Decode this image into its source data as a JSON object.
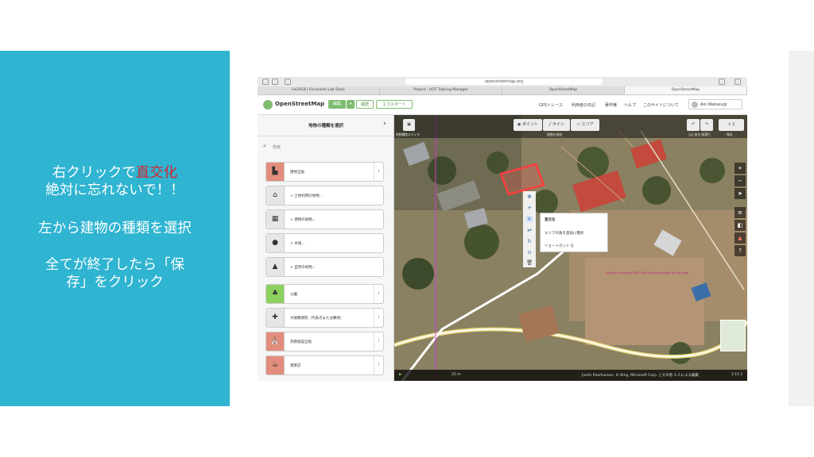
{
  "slide": {
    "line1_prefix": "右クリックで",
    "line1_highlight": "直交化",
    "line2": "絶対に忘れないで！！",
    "line3": "左から建物の種類を選択",
    "line4": "全てが終了したら「保",
    "line5": "存」をクリック",
    "highlight_color": "#d8232a",
    "panel_color": "#2fb4d1"
  },
  "browser": {
    "url": "openstreetmap.org",
    "tabs": [
      {
        "label": "sis2018 | Furuhashi Lab Slack"
      },
      {
        "label": "Project - HOT Tasking Manager"
      },
      {
        "label": "OpenStreetMap"
      },
      {
        "label": "OpenStreetMap"
      }
    ]
  },
  "osm_header": {
    "title": "OpenStreetMap",
    "edit_label": "編集",
    "history_label": "履歴",
    "export_label": "エクスポート",
    "links": [
      "GPSトレース",
      "利用者の日記",
      "著作権",
      "ヘルプ",
      "このサイトについて"
    ],
    "user": "Aoi Wakasugi"
  },
  "sidebar": {
    "title": "地物の種類を選択",
    "search_placeholder": "検索",
    "presets": [
      {
        "label": "建物全般",
        "icon": "building-icon"
      },
      {
        "label": "> 土地利用の地物...",
        "icon": "landuse-icon"
      },
      {
        "label": "> 建物の地物...",
        "icon": "building-group-icon"
      },
      {
        "label": "> 水域...",
        "icon": "water-icon"
      },
      {
        "label": "> 自然の地物...",
        "icon": "nature-icon"
      },
      {
        "label": "公園",
        "icon": "tree-icon"
      },
      {
        "label": "大規模病院（代表点または敷地）",
        "icon": "hospital-icon"
      },
      {
        "label": "宗教施設全般",
        "icon": "religious-icon"
      },
      {
        "label": "喫茶店",
        "icon": "cafe-icon"
      }
    ]
  },
  "map": {
    "toolbar": {
      "sidebar_label": "地物種別エディタ",
      "point_label": "ポイント",
      "line_label": "ライン",
      "area_label": "エリア",
      "add_label": "地物を追加",
      "undo_label": "元に戻す/再実行",
      "save_label": "保存",
      "save_count": "1"
    },
    "context_menu": {
      "title": "直交化",
      "description": "エリアの角を直角に整形",
      "shortcut": "ショートカット Q"
    },
    "warning": "Look for unsaved OSM Obj that are outside of this area",
    "scale": "25 m",
    "attribution": "Justin Rasmussen, © Bing, Microsoft Corp. とその他 3 人による編集",
    "version": "2.15.1"
  }
}
